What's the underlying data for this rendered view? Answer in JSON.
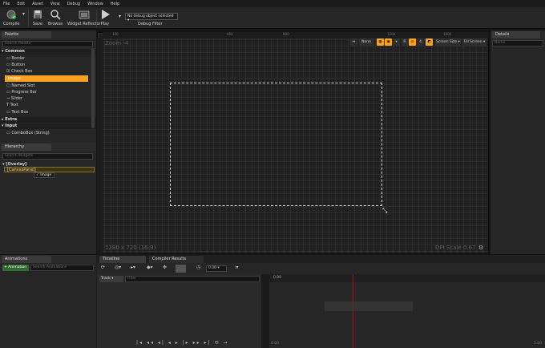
{
  "menu": [
    "File",
    "Edit",
    "Asset",
    "View",
    "Debug",
    "Window",
    "Help"
  ],
  "toolbar": {
    "compile": "Compile",
    "save": "Save",
    "browse": "Browse",
    "widget_reflector": "Widget Reflector",
    "play": "Play",
    "debug_object": "No debug object selected",
    "debug_filter": "Debug Filter"
  },
  "palette": {
    "tab": "Palette",
    "search_placeholder": "Search Palette",
    "categories": [
      "Common",
      "Extra",
      "Input"
    ],
    "common_items": [
      "Border",
      "Button",
      "Check Box",
      "Image",
      "Named Slot",
      "Progress Bar",
      "Slider",
      "Text",
      "Text Box"
    ],
    "input_items": [
      "ComboBox (String)"
    ]
  },
  "hierarchy": {
    "tab": "Hierarchy",
    "search_placeholder": "Search Widgets",
    "root": "[Overlay]",
    "child": "[CanvasPanel]",
    "selected": "Image"
  },
  "designer": {
    "zoom": "Zoom -4",
    "none_label": "None",
    "buttons": [
      "R",
      "4"
    ],
    "screen_size": "Screen Size",
    "fill_screen": "Fill Screen",
    "resolution": "1280 x 720 (16:9)",
    "dpi": "DPI Scale 0.67",
    "ruler_ticks": [
      "100",
      "400",
      "800",
      "1200",
      "1600"
    ]
  },
  "details": {
    "tab": "Details",
    "search_placeholder": "Name"
  },
  "animations": {
    "tab": "Animations",
    "add_button": "+ Animation",
    "search_placeholder": "Search Animations"
  },
  "timeline": {
    "tabs": [
      "Timeline",
      "Compiler Results"
    ],
    "track_button": "Track",
    "filter_placeholder": "Filter",
    "time": "0.00",
    "start": "0.00",
    "end": "5.00",
    "ruler_start": "0.00"
  },
  "colors": {
    "accent": "#f5a321",
    "background": "#141414",
    "panel": "#2a2a2a",
    "compile_green": "#3aa34a"
  }
}
